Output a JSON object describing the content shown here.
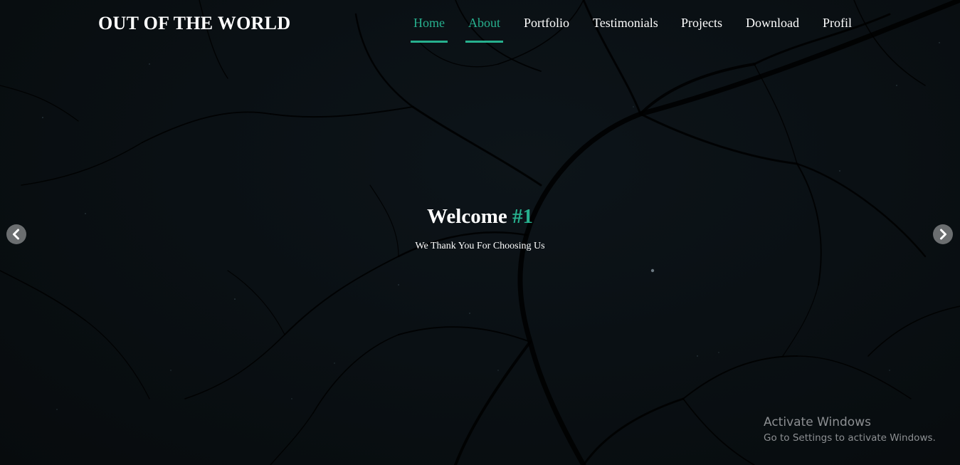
{
  "brand": {
    "title": "OUT OF THE WORLD"
  },
  "nav": {
    "items": [
      {
        "label": "Home",
        "active": true
      },
      {
        "label": "About",
        "active": true
      },
      {
        "label": "Portfolio",
        "active": false
      },
      {
        "label": "Testimonials",
        "active": false
      },
      {
        "label": "Projects",
        "active": false
      },
      {
        "label": "Download",
        "active": false
      },
      {
        "label": "Profil",
        "active": false
      }
    ]
  },
  "slider": {
    "title": "Welcome",
    "title_accent": "#1",
    "subtitle": "We Thank You For Choosing Us",
    "prev_icon": "chevron-left-icon",
    "next_icon": "chevron-right-icon"
  },
  "watermark": {
    "title": "Activate Windows",
    "subtitle": "Go to Settings to activate Windows."
  },
  "colors": {
    "accent": "#27b08e",
    "text": "#ffffff",
    "background": "#0a1014",
    "arrow_bg": "#6b6e70"
  }
}
